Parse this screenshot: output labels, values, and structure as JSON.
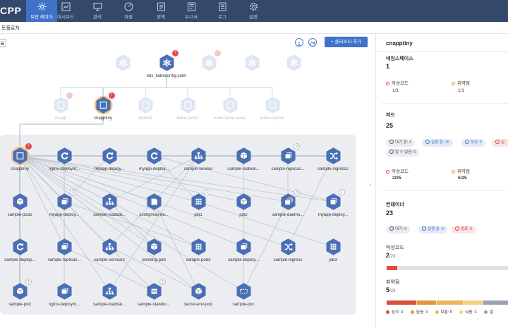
{
  "app": {
    "brand": "CPP"
  },
  "nav": [
    {
      "label": "보안 레이더",
      "icon": "radar-icon",
      "active": true
    },
    {
      "label": "대시보드",
      "icon": "dashboard-icon",
      "active": false
    },
    {
      "label": "관리",
      "icon": "monitor-icon",
      "active": false
    },
    {
      "label": "자원",
      "icon": "gauge-icon",
      "active": false
    },
    {
      "label": "정책",
      "icon": "policy-icon",
      "active": false
    },
    {
      "label": "보고서",
      "icon": "report-icon",
      "active": false
    },
    {
      "label": "로그",
      "icon": "log-icon",
      "active": false
    },
    {
      "label": "설정",
      "icon": "gear-icon",
      "active": false
    }
  ],
  "breadcrumb": "토폴로지",
  "toolbar": {
    "add_cluster_label": "클러스터 추가"
  },
  "topology": {
    "clusters": [
      {
        "name": "",
        "faded": true
      },
      {
        "name": "k8s_kubeconfig.yaml",
        "faded": false,
        "badge": "!"
      },
      {
        "name": "",
        "faded": true,
        "badge": "!"
      },
      {
        "name": "",
        "faded": true
      },
      {
        "name": "",
        "faded": true
      }
    ],
    "namespaces": [
      {
        "name": "cnapp",
        "faded": true,
        "badge": "!"
      },
      {
        "name": "cnapptiny",
        "faded": false,
        "badge": "!"
      },
      {
        "name": "default",
        "faded": true
      },
      {
        "name": "kube-public",
        "faded": true
      },
      {
        "name": "kube-node-lease",
        "faded": true
      },
      {
        "name": "kube-system",
        "faded": true
      }
    ],
    "resources": [
      {
        "name": "cnapptiny",
        "icon": "namespace-icon",
        "badge": "!"
      },
      {
        "name": "nginx-deploym...",
        "icon": "deployment-icon"
      },
      {
        "name": "myapp-deploy...",
        "icon": "deployment-icon"
      },
      {
        "name": "myapp-deploy...",
        "icon": "deployment-icon"
      },
      {
        "name": "sample-service",
        "icon": "service-icon"
      },
      {
        "name": "sample-malwar...",
        "icon": "pod-icon"
      },
      {
        "name": "sample-replicas...",
        "icon": "replicaset-icon",
        "badge": "2"
      },
      {
        "name": "sample-ingress2",
        "icon": "ingress-icon"
      },
      {
        "name": "sample-pod2",
        "icon": "pod-icon"
      },
      {
        "name": "myapp-deploy...",
        "icon": "replicaset-icon",
        "badge": "3"
      },
      {
        "name": "sample-loadbal...",
        "icon": "service-icon"
      },
      {
        "name": "configmap-de...",
        "icon": "configmap-icon"
      },
      {
        "name": "job1",
        "icon": "job-icon",
        "badge": "1"
      },
      {
        "name": "job2",
        "icon": "pod-icon"
      },
      {
        "name": "sample-daemo...",
        "icon": "daemonset-icon",
        "badge": "3"
      },
      {
        "name": "myapp-deploy...",
        "icon": "replicaset-icon",
        "badge": "1"
      },
      {
        "name": "sample-deploy...",
        "icon": "deployment-icon"
      },
      {
        "name": "sample-replicas...",
        "icon": "replicaset-icon"
      },
      {
        "name": "sample-service2",
        "icon": "service-icon"
      },
      {
        "name": "pending-pod",
        "icon": "pod-icon"
      },
      {
        "name": "sample-pod3",
        "icon": "job-icon"
      },
      {
        "name": "sample-deploy...",
        "icon": "replicaset-icon"
      },
      {
        "name": "sample-ingress",
        "icon": "ingress-icon"
      },
      {
        "name": "job3",
        "icon": "job-icon"
      },
      {
        "name": "sample-pod",
        "icon": "pod-icon",
        "badge": "1"
      },
      {
        "name": "nginx-deploym...",
        "icon": "replicaset-icon"
      },
      {
        "name": "sample-loadbal...",
        "icon": "service-icon"
      },
      {
        "name": "sample-stateful...",
        "icon": "statefulset-icon",
        "badge": "2"
      },
      {
        "name": "secret-env-pod",
        "icon": "pod-icon"
      },
      {
        "name": "sample-pvc",
        "icon": "pvc-icon"
      }
    ]
  },
  "detail": {
    "title": "cnapptiny",
    "namespace_label": "네임스페이스",
    "namespace_count": "1",
    "malware_label": "악성코드",
    "vuln_label": "취약점",
    "ns_malware": "1/1",
    "ns_vuln": "1/1",
    "pod_label": "파드",
    "pod_count": "25",
    "pod_chips": [
      "대기 중: 4",
      "실행 중: 15",
      "성공: 6",
      "실",
      "알 수 없음: 0"
    ],
    "pod_malware": "2/25",
    "pod_vuln": "5/25",
    "container_label": "컨테이너",
    "container_count": "23",
    "container_chips": [
      "대기: 9",
      "실행 중: 8",
      "종료: 6"
    ],
    "malware_section_label": "악성코드",
    "malware_ratio": "2",
    "malware_total": "/23",
    "vuln_section_label": "취약점",
    "vuln_ratio": "5",
    "vuln_total": "/23",
    "severity_legend": [
      "심각: 3",
      "높음: 3",
      "보통: 5",
      "낮음: 3",
      "알"
    ],
    "colors": {
      "accent": "#3f72c9",
      "malware": "#e24a3b",
      "vuln": "#f08c2e",
      "critical": "#d8503c",
      "high": "#e8953a",
      "medium": "#f0b45a",
      "low": "#f3d27e",
      "unknown": "#9aa3b0"
    }
  },
  "malware_bar_fraction": 0.087,
  "vuln_bar_fractions": [
    0.25,
    0.16,
    0.22,
    0.16,
    0.21
  ]
}
